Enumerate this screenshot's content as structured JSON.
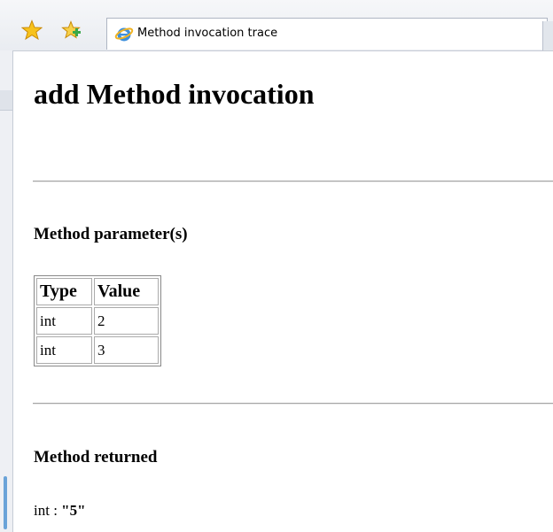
{
  "browser": {
    "tab_title": "Method invocation trace",
    "icons": [
      "favorites-star-icon",
      "add-favorites-icon",
      "ie-page-icon"
    ]
  },
  "page": {
    "title": "add Method invocation",
    "parameters_heading": "Method parameter(s)",
    "parameters_table": {
      "columns": [
        "Type",
        "Value"
      ],
      "rows": [
        {
          "type": "int",
          "value": "2"
        },
        {
          "type": "int",
          "value": "3"
        }
      ]
    },
    "returned_heading": "Method returned",
    "return_type": "int : ",
    "return_value": "\"5\""
  },
  "colors": {
    "chrome_bg": "#e9ecf1",
    "rule": "#a5a5a5",
    "table_border": "#aaaaaa"
  }
}
